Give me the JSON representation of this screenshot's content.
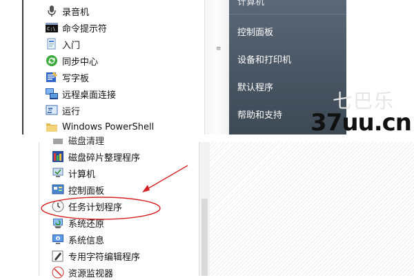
{
  "top_menu": {
    "items": [
      {
        "label": "录音机",
        "icon": "microphone-icon"
      },
      {
        "label": "命令提示符",
        "icon": "command-prompt-icon"
      },
      {
        "label": "入门",
        "icon": "getting-started-icon"
      },
      {
        "label": "同步中心",
        "icon": "sync-center-icon"
      },
      {
        "label": "写字板",
        "icon": "wordpad-icon"
      },
      {
        "label": "远程桌面连接",
        "icon": "remote-desktop-icon"
      },
      {
        "label": "运行",
        "icon": "run-icon"
      },
      {
        "label": "Windows PowerShell",
        "icon": "folder-icon"
      }
    ],
    "right_panel": {
      "cutoff_label": "计算机",
      "items": [
        "控制面板",
        "设备和打印机",
        "默认程序",
        "帮助和支持"
      ]
    }
  },
  "bottom_menu": {
    "cutoff_label": "磁盘清理",
    "items": [
      {
        "label": "磁盘碎片整理程序",
        "icon": "defrag-icon"
      },
      {
        "label": "计算机",
        "icon": "computer-icon"
      },
      {
        "label": "控制面板",
        "icon": "control-panel-icon"
      },
      {
        "label": "任务计划程序",
        "icon": "clock-icon",
        "highlighted": true
      },
      {
        "label": "系统还原",
        "icon": "system-restore-icon"
      },
      {
        "label": "系统信息",
        "icon": "system-info-icon"
      },
      {
        "label": "专用字符编辑程序",
        "icon": "char-editor-icon"
      },
      {
        "label": "资源监视器",
        "icon": "resource-monitor-icon"
      }
    ]
  },
  "watermark": {
    "text": "37uu.cn",
    "faint": "七巴乐"
  },
  "colors": {
    "start_menu_right": "#4d5a67",
    "annotation_red": "#d42020",
    "text": "#111111"
  }
}
